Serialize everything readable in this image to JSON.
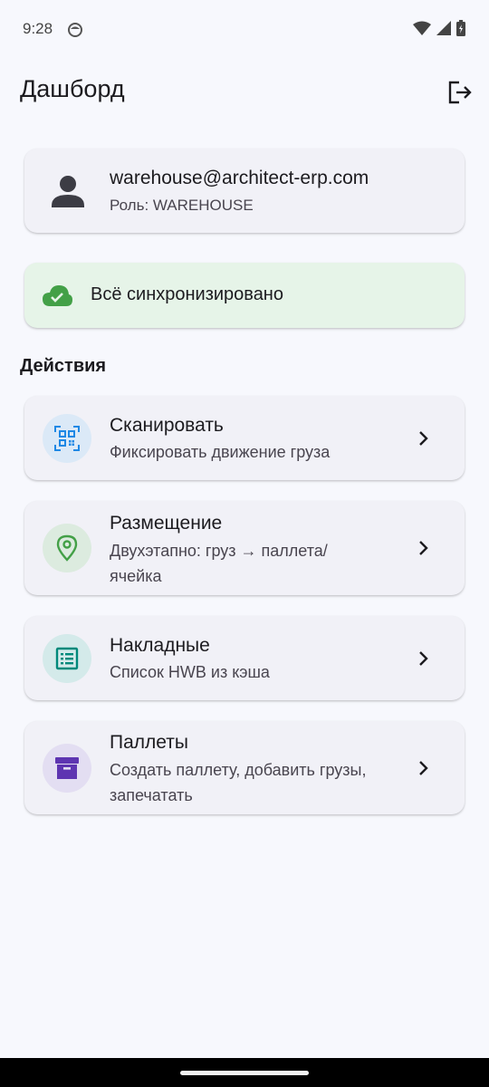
{
  "status_bar": {
    "time": "9:28"
  },
  "header": {
    "title": "Дашборд"
  },
  "user": {
    "email": "warehouse@architect-erp.com",
    "role": "Роль: WAREHOUSE"
  },
  "sync": {
    "text": "Всё синхронизировано"
  },
  "actions_section": {
    "title": "Действия",
    "items": [
      {
        "title": "Сканировать",
        "subtitle": "Фиксировать движение груза",
        "icon": "qr-scan-icon",
        "color": "#1e88e5",
        "bg": "#dbe9f7"
      },
      {
        "title": "Размещение",
        "subtitle": "Двухэтапно: груз → паллета/ ячейка",
        "icon": "location-pin-icon",
        "color": "#43a047",
        "bg": "#dcebdf"
      },
      {
        "title": "Накладные",
        "subtitle": "Список HWB из кэша",
        "icon": "list-document-icon",
        "color": "#00897b",
        "bg": "#d4eaea"
      },
      {
        "title": "Паллеты",
        "subtitle": "Создать паллету, добавить грузы, запечатать",
        "icon": "archive-box-icon",
        "color": "#5e35b1",
        "bg": "#e3def2"
      }
    ]
  }
}
